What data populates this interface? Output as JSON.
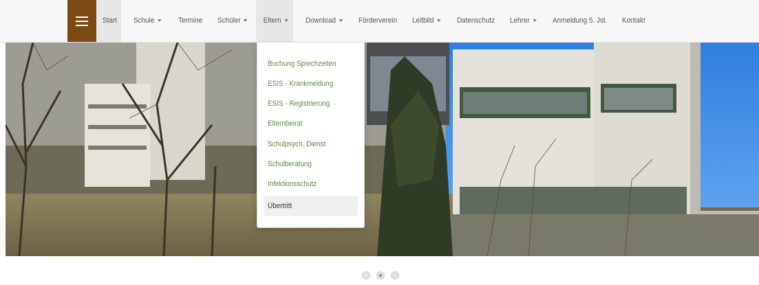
{
  "nav": {
    "menu_icon": "hamburger-icon",
    "brand_color": "#7b4a13",
    "items": [
      {
        "label": "Start",
        "active": true,
        "dropdown": false
      },
      {
        "label": "Schule",
        "dropdown": true
      },
      {
        "label": "Termine",
        "dropdown": false
      },
      {
        "label": "Schüler",
        "dropdown": true
      },
      {
        "label": "Eltern",
        "dropdown": true,
        "open": true
      },
      {
        "label": "Download",
        "dropdown": true
      },
      {
        "label": "Förderverein",
        "dropdown": false
      },
      {
        "label": "Leitbild",
        "dropdown": true
      },
      {
        "label": "Datenschutz",
        "dropdown": false
      },
      {
        "label": "Lehrer",
        "dropdown": true
      },
      {
        "label": "Anmeldung 5. Jst.",
        "dropdown": false
      },
      {
        "label": "Kontakt",
        "dropdown": false
      }
    ]
  },
  "eltern_menu": {
    "link_color": "#5a8a3a",
    "items": [
      {
        "label": "Buchung Sprechzeiten"
      },
      {
        "label": "ESIS - Krankmeldung"
      },
      {
        "label": "ESIS - Registrierung"
      },
      {
        "label": "Elternbeirat"
      },
      {
        "label": "Schulpsych. Dienst"
      },
      {
        "label": "Schulberatung"
      },
      {
        "label": "Infektionsschutz"
      },
      {
        "label": "Übertritt",
        "hovered": true
      }
    ]
  },
  "carousel": {
    "slide_count": 3,
    "active_index": 1
  }
}
